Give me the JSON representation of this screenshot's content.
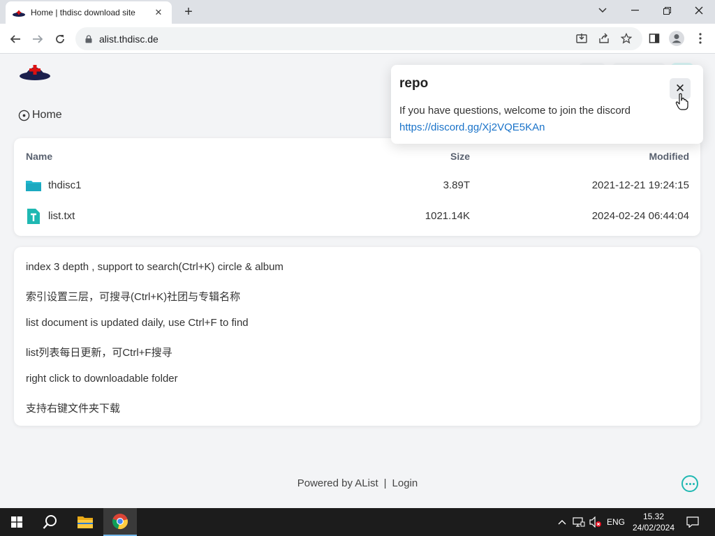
{
  "browser": {
    "tab_title": "Home | thdisc download site",
    "url": "alist.thdisc.de",
    "icons": [
      "back-arrow-icon",
      "forward-arrow-icon",
      "reload-icon",
      "lock-icon",
      "install-app-icon",
      "share-icon",
      "bookmark-star-icon",
      "side-panel-icon",
      "profile-icon",
      "kebab-menu-icon"
    ]
  },
  "breadcrumb": {
    "home_label": "Home"
  },
  "files": {
    "columns": {
      "name": "Name",
      "size": "Size",
      "modified": "Modified"
    },
    "rows": [
      {
        "name": "thdisc1",
        "size": "3.89T",
        "modified": "2021-12-21 19:24:15",
        "icon": "folder-icon"
      },
      {
        "name": "list.txt",
        "size": "1021.14K",
        "modified": "2024-02-24 06:44:04",
        "icon": "text-file-icon"
      }
    ]
  },
  "readme": {
    "lines": [
      "index 3 depth , support to search(Ctrl+K) circle & album",
      "索引设置三层，可搜寻(Ctrl+K)社团与专辑名称",
      "list document is updated daily, use Ctrl+F to find",
      "list列表每日更新，可Ctrl+F搜寻",
      "right click to downloadable folder",
      "支持右键文件夹下载"
    ]
  },
  "footer": {
    "powered": "Powered by AList",
    "separator": "|",
    "login": "Login"
  },
  "notification": {
    "title": "repo",
    "message": "If you have questions, welcome to join the discord",
    "link": "https://discord.gg/Xj2VQE5KAn"
  },
  "taskbar": {
    "language": "ENG",
    "time": "15.32",
    "date": "24/02/2024"
  },
  "colors": {
    "accent": "#1fb8b2",
    "link": "#1a73c9",
    "taskbar": "#1c1c1c"
  }
}
